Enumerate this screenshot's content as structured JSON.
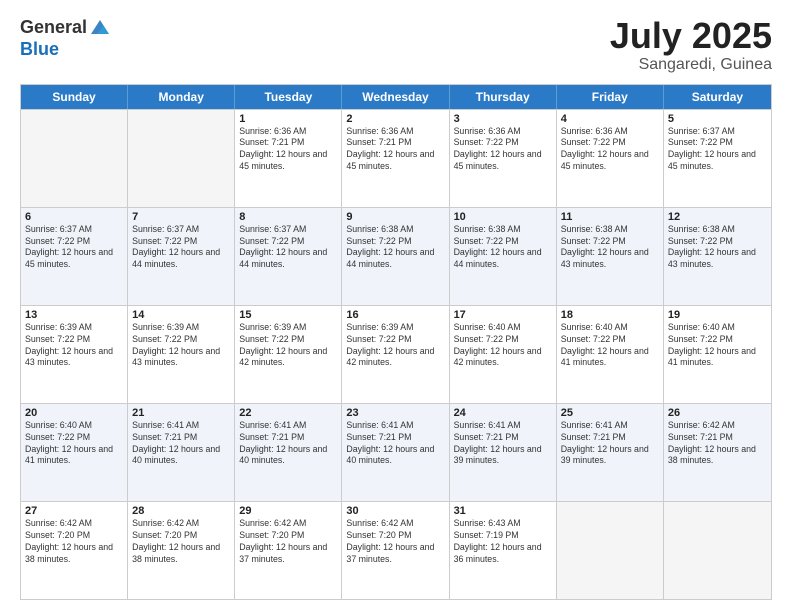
{
  "logo": {
    "general": "General",
    "blue": "Blue"
  },
  "title": {
    "month": "July 2025",
    "location": "Sangaredi, Guinea"
  },
  "weekdays": [
    "Sunday",
    "Monday",
    "Tuesday",
    "Wednesday",
    "Thursday",
    "Friday",
    "Saturday"
  ],
  "rows": [
    {
      "alt": false,
      "cells": [
        {
          "day": "",
          "sunrise": "",
          "sunset": "",
          "daylight": ""
        },
        {
          "day": "",
          "sunrise": "",
          "sunset": "",
          "daylight": ""
        },
        {
          "day": "1",
          "sunrise": "Sunrise: 6:36 AM",
          "sunset": "Sunset: 7:21 PM",
          "daylight": "Daylight: 12 hours and 45 minutes."
        },
        {
          "day": "2",
          "sunrise": "Sunrise: 6:36 AM",
          "sunset": "Sunset: 7:21 PM",
          "daylight": "Daylight: 12 hours and 45 minutes."
        },
        {
          "day": "3",
          "sunrise": "Sunrise: 6:36 AM",
          "sunset": "Sunset: 7:22 PM",
          "daylight": "Daylight: 12 hours and 45 minutes."
        },
        {
          "day": "4",
          "sunrise": "Sunrise: 6:36 AM",
          "sunset": "Sunset: 7:22 PM",
          "daylight": "Daylight: 12 hours and 45 minutes."
        },
        {
          "day": "5",
          "sunrise": "Sunrise: 6:37 AM",
          "sunset": "Sunset: 7:22 PM",
          "daylight": "Daylight: 12 hours and 45 minutes."
        }
      ]
    },
    {
      "alt": true,
      "cells": [
        {
          "day": "6",
          "sunrise": "Sunrise: 6:37 AM",
          "sunset": "Sunset: 7:22 PM",
          "daylight": "Daylight: 12 hours and 45 minutes."
        },
        {
          "day": "7",
          "sunrise": "Sunrise: 6:37 AM",
          "sunset": "Sunset: 7:22 PM",
          "daylight": "Daylight: 12 hours and 44 minutes."
        },
        {
          "day": "8",
          "sunrise": "Sunrise: 6:37 AM",
          "sunset": "Sunset: 7:22 PM",
          "daylight": "Daylight: 12 hours and 44 minutes."
        },
        {
          "day": "9",
          "sunrise": "Sunrise: 6:38 AM",
          "sunset": "Sunset: 7:22 PM",
          "daylight": "Daylight: 12 hours and 44 minutes."
        },
        {
          "day": "10",
          "sunrise": "Sunrise: 6:38 AM",
          "sunset": "Sunset: 7:22 PM",
          "daylight": "Daylight: 12 hours and 44 minutes."
        },
        {
          "day": "11",
          "sunrise": "Sunrise: 6:38 AM",
          "sunset": "Sunset: 7:22 PM",
          "daylight": "Daylight: 12 hours and 43 minutes."
        },
        {
          "day": "12",
          "sunrise": "Sunrise: 6:38 AM",
          "sunset": "Sunset: 7:22 PM",
          "daylight": "Daylight: 12 hours and 43 minutes."
        }
      ]
    },
    {
      "alt": false,
      "cells": [
        {
          "day": "13",
          "sunrise": "Sunrise: 6:39 AM",
          "sunset": "Sunset: 7:22 PM",
          "daylight": "Daylight: 12 hours and 43 minutes."
        },
        {
          "day": "14",
          "sunrise": "Sunrise: 6:39 AM",
          "sunset": "Sunset: 7:22 PM",
          "daylight": "Daylight: 12 hours and 43 minutes."
        },
        {
          "day": "15",
          "sunrise": "Sunrise: 6:39 AM",
          "sunset": "Sunset: 7:22 PM",
          "daylight": "Daylight: 12 hours and 42 minutes."
        },
        {
          "day": "16",
          "sunrise": "Sunrise: 6:39 AM",
          "sunset": "Sunset: 7:22 PM",
          "daylight": "Daylight: 12 hours and 42 minutes."
        },
        {
          "day": "17",
          "sunrise": "Sunrise: 6:40 AM",
          "sunset": "Sunset: 7:22 PM",
          "daylight": "Daylight: 12 hours and 42 minutes."
        },
        {
          "day": "18",
          "sunrise": "Sunrise: 6:40 AM",
          "sunset": "Sunset: 7:22 PM",
          "daylight": "Daylight: 12 hours and 41 minutes."
        },
        {
          "day": "19",
          "sunrise": "Sunrise: 6:40 AM",
          "sunset": "Sunset: 7:22 PM",
          "daylight": "Daylight: 12 hours and 41 minutes."
        }
      ]
    },
    {
      "alt": true,
      "cells": [
        {
          "day": "20",
          "sunrise": "Sunrise: 6:40 AM",
          "sunset": "Sunset: 7:22 PM",
          "daylight": "Daylight: 12 hours and 41 minutes."
        },
        {
          "day": "21",
          "sunrise": "Sunrise: 6:41 AM",
          "sunset": "Sunset: 7:21 PM",
          "daylight": "Daylight: 12 hours and 40 minutes."
        },
        {
          "day": "22",
          "sunrise": "Sunrise: 6:41 AM",
          "sunset": "Sunset: 7:21 PM",
          "daylight": "Daylight: 12 hours and 40 minutes."
        },
        {
          "day": "23",
          "sunrise": "Sunrise: 6:41 AM",
          "sunset": "Sunset: 7:21 PM",
          "daylight": "Daylight: 12 hours and 40 minutes."
        },
        {
          "day": "24",
          "sunrise": "Sunrise: 6:41 AM",
          "sunset": "Sunset: 7:21 PM",
          "daylight": "Daylight: 12 hours and 39 minutes."
        },
        {
          "day": "25",
          "sunrise": "Sunrise: 6:41 AM",
          "sunset": "Sunset: 7:21 PM",
          "daylight": "Daylight: 12 hours and 39 minutes."
        },
        {
          "day": "26",
          "sunrise": "Sunrise: 6:42 AM",
          "sunset": "Sunset: 7:21 PM",
          "daylight": "Daylight: 12 hours and 38 minutes."
        }
      ]
    },
    {
      "alt": false,
      "cells": [
        {
          "day": "27",
          "sunrise": "Sunrise: 6:42 AM",
          "sunset": "Sunset: 7:20 PM",
          "daylight": "Daylight: 12 hours and 38 minutes."
        },
        {
          "day": "28",
          "sunrise": "Sunrise: 6:42 AM",
          "sunset": "Sunset: 7:20 PM",
          "daylight": "Daylight: 12 hours and 38 minutes."
        },
        {
          "day": "29",
          "sunrise": "Sunrise: 6:42 AM",
          "sunset": "Sunset: 7:20 PM",
          "daylight": "Daylight: 12 hours and 37 minutes."
        },
        {
          "day": "30",
          "sunrise": "Sunrise: 6:42 AM",
          "sunset": "Sunset: 7:20 PM",
          "daylight": "Daylight: 12 hours and 37 minutes."
        },
        {
          "day": "31",
          "sunrise": "Sunrise: 6:43 AM",
          "sunset": "Sunset: 7:19 PM",
          "daylight": "Daylight: 12 hours and 36 minutes."
        },
        {
          "day": "",
          "sunrise": "",
          "sunset": "",
          "daylight": ""
        },
        {
          "day": "",
          "sunrise": "",
          "sunset": "",
          "daylight": ""
        }
      ]
    }
  ]
}
